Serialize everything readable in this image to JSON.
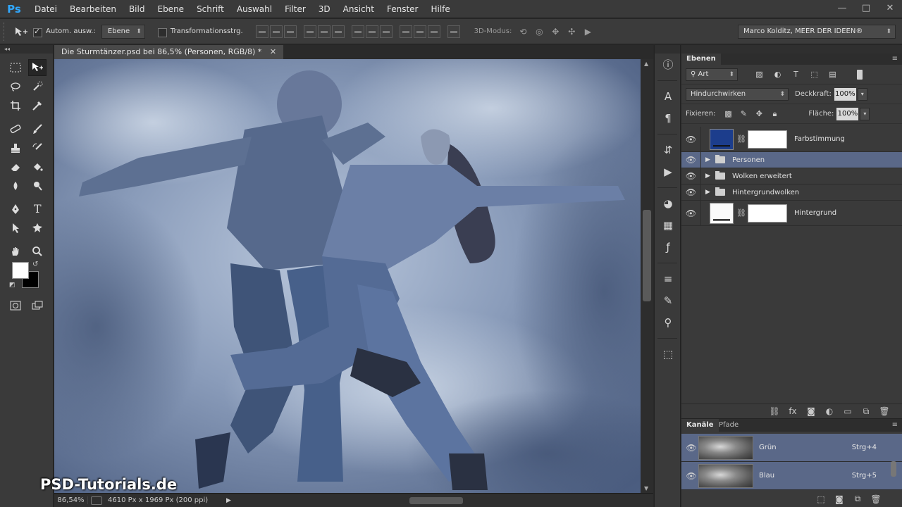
{
  "app": {
    "logo": "Ps",
    "menu": [
      "Datei",
      "Bearbeiten",
      "Bild",
      "Ebene",
      "Schrift",
      "Auswahl",
      "Filter",
      "3D",
      "Ansicht",
      "Fenster",
      "Hilfe"
    ],
    "window_controls": [
      "—",
      "□",
      "✕"
    ]
  },
  "options_bar": {
    "auto_select_label": "Autom. ausw.:",
    "auto_select_checked": true,
    "auto_select_target": "Ebene",
    "transform_controls_label": "Transformationsstrg.",
    "transform_controls_checked": false,
    "mode_3d_label": "3D-Modus:",
    "workspace": "Marco Kolditz, MEER DER IDEEN®"
  },
  "tools": {
    "foreground_color": "#ffffff",
    "background_color": "#000000"
  },
  "document": {
    "tab_title": "Die Sturmtänzer.psd bei 86,5% (Personen, RGB/8) *",
    "close_symbol": "✕",
    "watermark": "PSD-Tutorials.de"
  },
  "status": {
    "zoom": "86,54%",
    "doc_info": "4610 Px x 1969 Px (200 ppi)",
    "arrow": "▶"
  },
  "layers_panel": {
    "tab_label": "Ebenen",
    "filter_kind": "Art",
    "blend_mode": "Hindurchwirken",
    "opacity_label": "Deckkraft:",
    "opacity_value": "100%",
    "lock_label": "Fixieren:",
    "fill_label": "Fläche:",
    "fill_value": "100%",
    "layers": [
      {
        "name": "Farbstimmung",
        "type": "adjustment",
        "visible": true,
        "selected": false
      },
      {
        "name": "Personen",
        "type": "group",
        "visible": true,
        "selected": true
      },
      {
        "name": "Wolken erweitert",
        "type": "group",
        "visible": true,
        "selected": false
      },
      {
        "name": "Hintergrundwolken",
        "type": "group",
        "visible": true,
        "selected": false
      },
      {
        "name": "Hintergrund",
        "type": "image",
        "visible": true,
        "selected": false
      }
    ]
  },
  "channels_panel": {
    "tabs": [
      "Kanäle",
      "Pfade"
    ],
    "channels": [
      {
        "name": "Grün",
        "shortcut": "Strg+4",
        "selected": true
      },
      {
        "name": "Blau",
        "shortcut": "Strg+5",
        "selected": true
      }
    ]
  },
  "colors": {
    "accent_ps": "#31a8ff",
    "selection": "#5a6888",
    "panel_bg": "#3a3a3a"
  }
}
